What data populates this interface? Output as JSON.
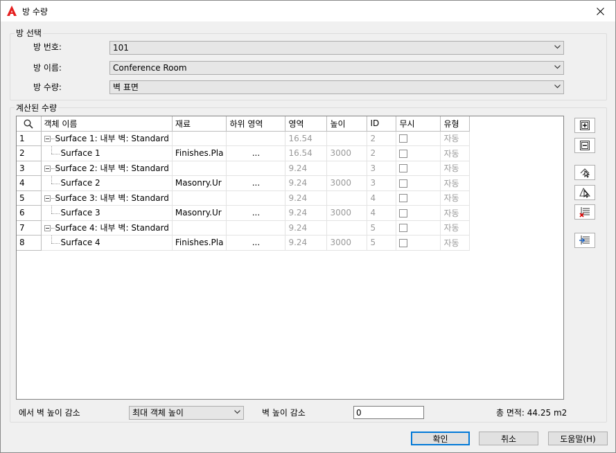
{
  "window": {
    "title": "방 수량"
  },
  "room_selection": {
    "group_label": "방 선택",
    "room_number_label": "방 번호:",
    "room_number_value": "101",
    "room_name_label": "방 이름:",
    "room_name_value": "Conference Room",
    "room_quantity_label": "방 수량:",
    "room_quantity_value": "벽 표면"
  },
  "calculated": {
    "group_label": "계산된 수량",
    "columns": [
      "객체 이름",
      "재료",
      "하위 영역",
      "영역",
      "높이",
      "ID",
      "무시",
      "유형"
    ],
    "rows": [
      {
        "num": "1",
        "name": "Surface 1: 내부 벽: Standard",
        "material": "",
        "sub": "",
        "area": "16.54",
        "height": "",
        "id": "2",
        "type": "자동",
        "level": 0
      },
      {
        "num": "2",
        "name": "Surface 1",
        "material": "Finishes.Pla",
        "sub": "...",
        "area": "16.54",
        "height": "3000",
        "id": "2",
        "type": "자동",
        "level": 1
      },
      {
        "num": "3",
        "name": "Surface 2: 내부 벽: Standard",
        "material": "",
        "sub": "",
        "area": "9.24",
        "height": "",
        "id": "3",
        "type": "자동",
        "level": 0
      },
      {
        "num": "4",
        "name": "Surface 2",
        "material": "Masonry.Ur",
        "sub": "...",
        "area": "9.24",
        "height": "3000",
        "id": "3",
        "type": "자동",
        "level": 1
      },
      {
        "num": "5",
        "name": "Surface 3: 내부 벽: Standard",
        "material": "",
        "sub": "",
        "area": "9.24",
        "height": "",
        "id": "4",
        "type": "자동",
        "level": 0
      },
      {
        "num": "6",
        "name": "Surface 3",
        "material": "Masonry.Ur",
        "sub": "...",
        "area": "9.24",
        "height": "3000",
        "id": "4",
        "type": "자동",
        "level": 1
      },
      {
        "num": "7",
        "name": "Surface 4: 내부 벽: Standard",
        "material": "",
        "sub": "",
        "area": "9.24",
        "height": "",
        "id": "5",
        "type": "자동",
        "level": 0
      },
      {
        "num": "8",
        "name": "Surface 4",
        "material": "Finishes.Pla",
        "sub": "...",
        "area": "9.24",
        "height": "3000",
        "id": "5",
        "type": "자동",
        "level": 1
      }
    ]
  },
  "footer": {
    "reduce_from_label": "에서 벽 높이 감소",
    "reduce_from_value": "최대 객체 높이",
    "reduce_by_label": "벽 높이 감소",
    "reduce_by_value": "0",
    "total_area": "총 면적: 44.25 m2"
  },
  "buttons": {
    "ok": "확인",
    "cancel": "취소",
    "help": "도움말(H)"
  },
  "icons": {
    "app": "autocad-icon",
    "close": "close-icon",
    "search": "search-icon",
    "expand": "expand-all-icon",
    "collapse": "collapse-all-icon",
    "select": "select-object-icon",
    "add_object": "add-object-icon",
    "remove": "remove-icon",
    "list": "list-icon"
  }
}
